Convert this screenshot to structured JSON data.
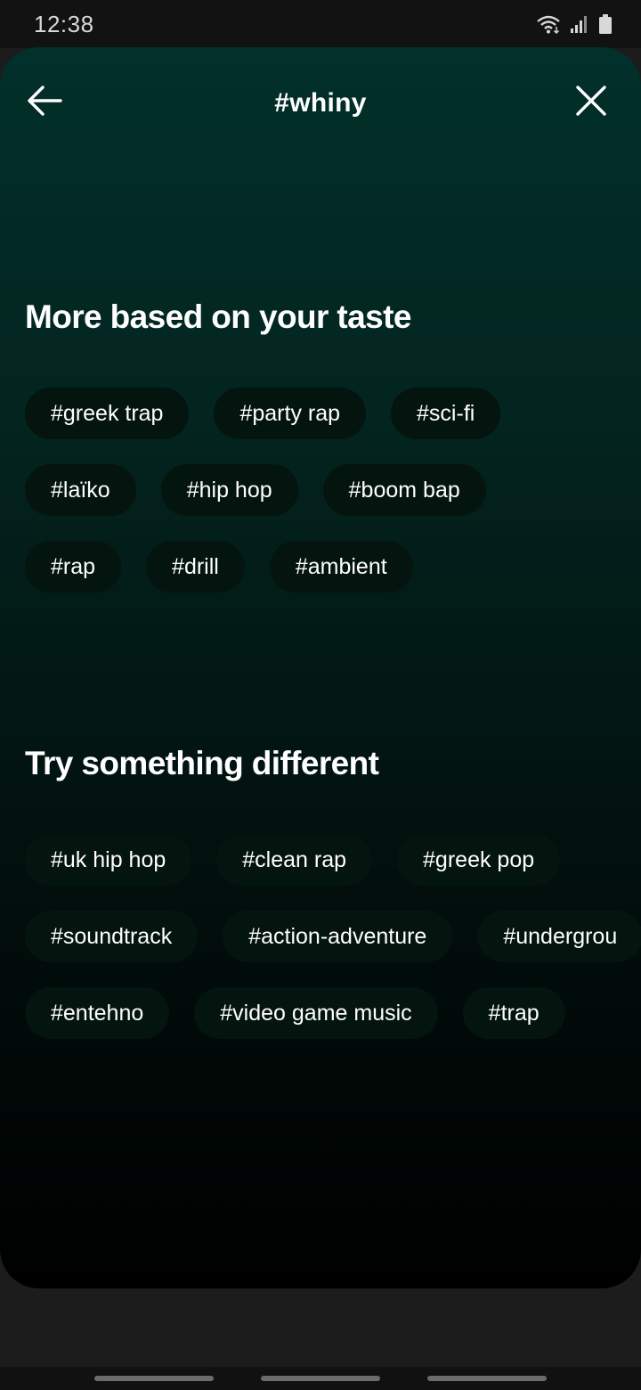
{
  "status_bar": {
    "time": "12:38",
    "icons": [
      "wifi-icon",
      "signal-icon",
      "battery-icon"
    ]
  },
  "header": {
    "back_icon": "arrow-left-icon",
    "title": "#whiny",
    "close_icon": "close-icon"
  },
  "sections": [
    {
      "title": "More based on your taste",
      "rows": [
        [
          "#greek trap",
          "#party rap",
          "#sci-fi"
        ],
        [
          "#laïko",
          "#hip hop",
          "#boom bap"
        ],
        [
          "#rap",
          "#drill",
          "#ambient"
        ]
      ]
    },
    {
      "title": "Try something different",
      "rows": [
        [
          "#uk hip hop",
          "#clean rap",
          "#greek pop"
        ],
        [
          "#soundtrack",
          "#action-adventure",
          "#undergrou"
        ],
        [
          "#entehno",
          "#video game music",
          "#trap"
        ]
      ]
    }
  ],
  "colors": {
    "sheet_top": "#02302a",
    "sheet_bottom": "#000000",
    "chip_bg": "#04140f"
  }
}
